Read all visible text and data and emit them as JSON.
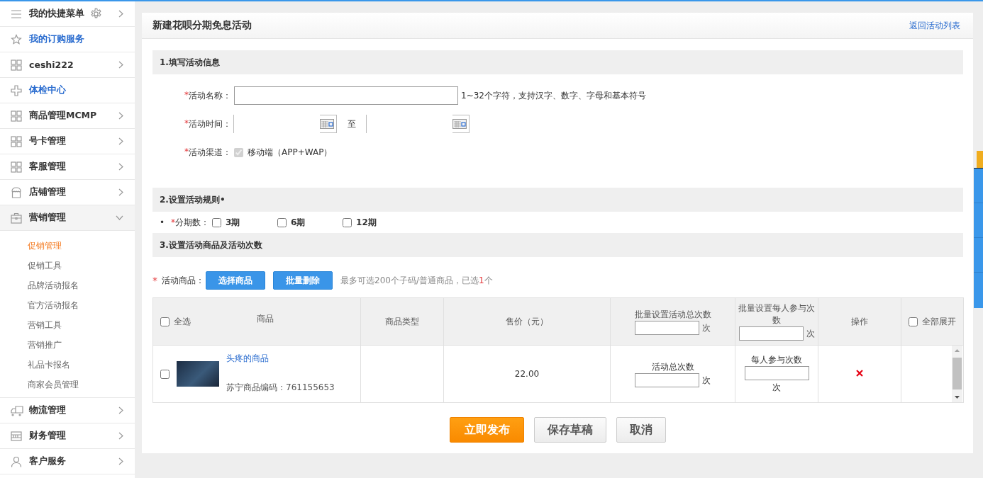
{
  "sidebar": {
    "items": [
      {
        "label": "我的快捷菜单",
        "kind": "group",
        "settings": true,
        "expanded": false
      },
      {
        "label": "我的订购服务",
        "kind": "link"
      },
      {
        "label": "ceshi222",
        "kind": "group",
        "expanded": false
      },
      {
        "label": "体检中心",
        "kind": "link"
      },
      {
        "label": "商品管理MCMP",
        "kind": "group",
        "expanded": false
      },
      {
        "label": "号卡管理",
        "kind": "group",
        "expanded": false
      },
      {
        "label": "客服管理",
        "kind": "group",
        "expanded": false
      },
      {
        "label": "店铺管理",
        "kind": "group",
        "expanded": false
      },
      {
        "label": "营销管理",
        "kind": "group",
        "expanded": true,
        "children": [
          {
            "label": "促销管理",
            "selected": true
          },
          {
            "label": "促销工具",
            "selected": false
          },
          {
            "label": "品牌活动报名",
            "selected": false
          },
          {
            "label": "官方活动报名",
            "selected": false
          },
          {
            "label": "营销工具",
            "selected": false
          },
          {
            "label": "营销推广",
            "selected": false
          },
          {
            "label": "礼品卡报名",
            "selected": false
          },
          {
            "label": "商家会员管理",
            "selected": false
          }
        ]
      },
      {
        "label": "物流管理",
        "kind": "group",
        "expanded": false
      },
      {
        "label": "财务管理",
        "kind": "group",
        "expanded": false
      },
      {
        "label": "客户服务",
        "kind": "group",
        "expanded": false
      }
    ]
  },
  "page": {
    "title": "新建花呗分期免息活动",
    "back_link": "返回活动列表"
  },
  "activity_info": {
    "heading": "1.填写活动信息",
    "name": {
      "required_mark": "*",
      "label": "活动名称：",
      "hint": "1~32个字符，支持汉字、数字、字母和基本符号"
    },
    "time": {
      "required_mark": "*",
      "label": "活动时间：",
      "separator": "至"
    },
    "channel": {
      "required_mark": "*",
      "label": "活动渠道：",
      "option": "移动端（APP+WAP）",
      "checked": true,
      "disabled": true
    }
  },
  "rules": {
    "heading": "2.设置活动规则•",
    "bullet": "•",
    "required_mark": "*",
    "label": "分期数：",
    "options": [
      {
        "label": "3期",
        "checked": false
      },
      {
        "label": "6期",
        "checked": false
      },
      {
        "label": "12期",
        "checked": false
      }
    ]
  },
  "products": {
    "heading": "3.设置活动商品及活动次数",
    "required_mark": "*",
    "label": "活动商品：",
    "buttons": [
      "选择商品",
      "批量删除"
    ],
    "limit_note": "最多可选200个子码/普通商品，已选 ",
    "selected_count": "1",
    "count_unit": "个"
  },
  "table": {
    "columns": [
      {
        "kind": "product",
        "label": "商品",
        "select_all": "全选",
        "checked": false
      },
      {
        "kind": "text",
        "label": "商品类型"
      },
      {
        "kind": "text",
        "label": "售价（元）"
      },
      {
        "kind": "input",
        "label": "批量设置活动总次数",
        "unit": "次"
      },
      {
        "kind": "input",
        "label": "批量设置每人参与次数",
        "unit": "次"
      },
      {
        "kind": "text",
        "label": "操作"
      },
      {
        "kind": "expand",
        "label": "全部展开",
        "checked": false
      }
    ],
    "rows": [
      {
        "checked": false,
        "name": "头疼的商品",
        "code": "苏宁商品编码：761155653",
        "price": "22.00",
        "total_label": "活动总次数",
        "total_unit": "次",
        "per_person_label": "每人参与次数",
        "per_person_unit": "次"
      }
    ]
  },
  "actions": [
    {
      "label": "立即发布",
      "kind": "primary"
    },
    {
      "label": "保存草稿",
      "kind": "secondary"
    },
    {
      "label": "取消",
      "kind": "secondary"
    }
  ]
}
